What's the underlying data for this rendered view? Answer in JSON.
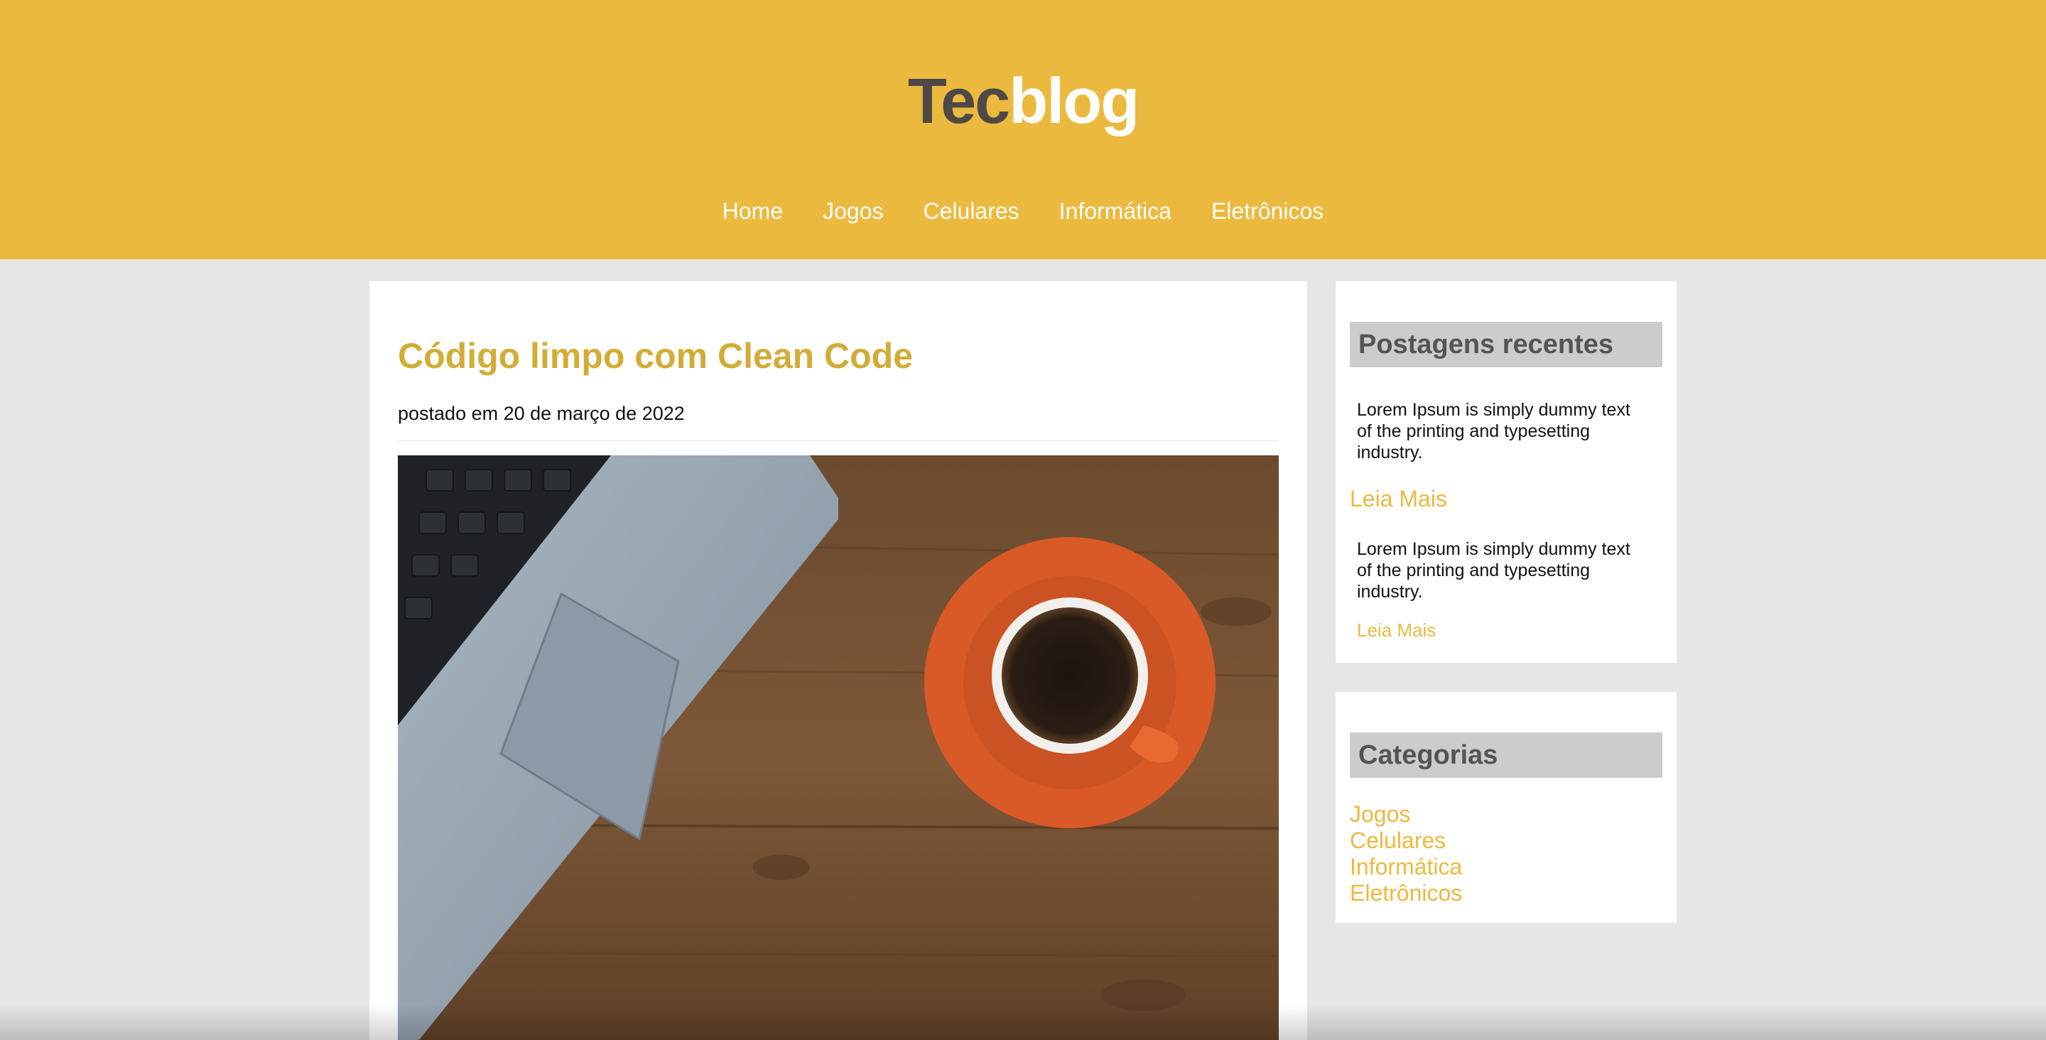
{
  "header": {
    "logo_part1": "Tec",
    "logo_part2": "blog",
    "nav": [
      "Home",
      "Jogos",
      "Celulares",
      "Informática",
      "Eletrônicos"
    ]
  },
  "post": {
    "title": "Código limpo com Clean Code",
    "date": "postado em 20 de março de 2022",
    "image": "laptop-and-coffee-cup-photo"
  },
  "sidebar": {
    "recent": {
      "heading": "Postagens recentes",
      "items": [
        {
          "text": "Lorem Ipsum is simply dummy text of the printing and typesetting industry.",
          "link": "Leia Mais"
        },
        {
          "text": "Lorem Ipsum is simply dummy text of the printing and typesetting industry.",
          "link": "Leia Mais"
        }
      ]
    },
    "categories": {
      "heading": "Categorias",
      "items": [
        "Jogos",
        "Celulares",
        "Informática",
        "Eletrônicos"
      ]
    }
  },
  "colors": {
    "accent": "#ecb93f",
    "title": "#d1ad37",
    "background": "#e6e6e6",
    "dark_text": "#4d4a45"
  }
}
